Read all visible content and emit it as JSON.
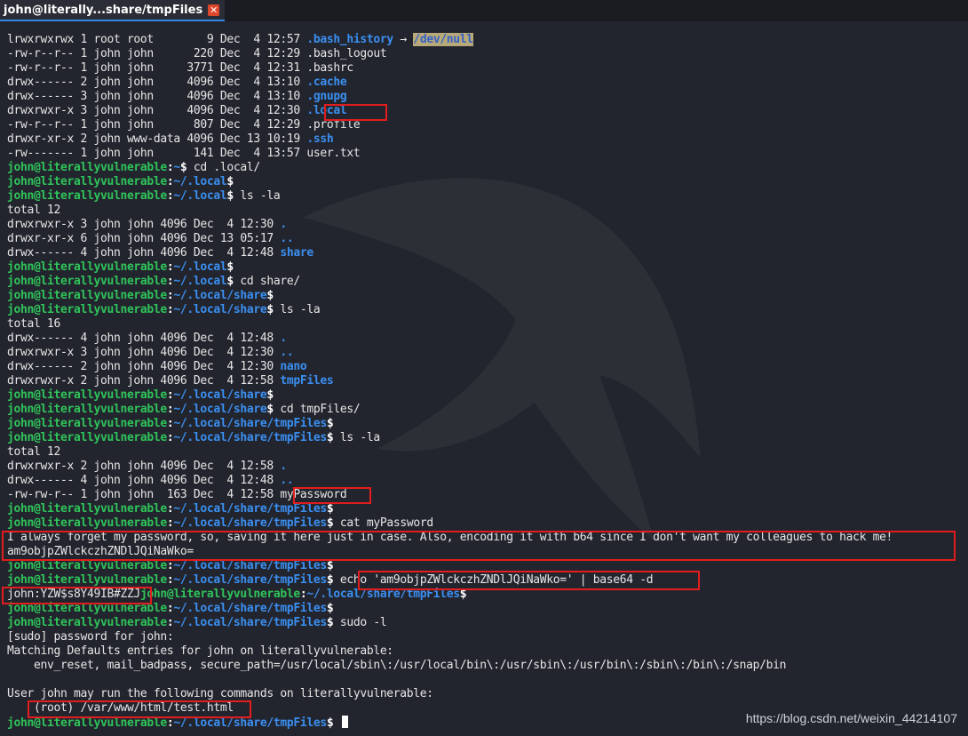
{
  "window": {
    "tab_title": "john@literally...share/tmpFiles",
    "tab_close_glyph": "✕"
  },
  "prompt": {
    "user_host": "john@literallyvulnerable",
    "colon": ":"
  },
  "terminal": {
    "lines": [
      {
        "type": "text",
        "segments": [
          {
            "t": "lrwxrwxrwx 1 root root        9 Dec  4 12:57 "
          },
          {
            "t": ".bash_history",
            "c": "blue"
          },
          {
            "t": " → "
          },
          {
            "t": "/dev/null",
            "c": "hl-null"
          }
        ]
      },
      {
        "type": "text",
        "segments": [
          {
            "t": "-rw-r--r-- 1 john john      220 Dec  4 12:29 .bash_logout"
          }
        ]
      },
      {
        "type": "text",
        "segments": [
          {
            "t": "-rw-r--r-- 1 john john     3771 Dec  4 12:31 .bashrc"
          }
        ]
      },
      {
        "type": "text",
        "segments": [
          {
            "t": "drwx------ 2 john john     4096 Dec  4 13:10 "
          },
          {
            "t": ".cache",
            "c": "blue"
          }
        ]
      },
      {
        "type": "text",
        "segments": [
          {
            "t": "drwx------ 3 john john     4096 Dec  4 13:10 "
          },
          {
            "t": ".gnupg",
            "c": "blue"
          }
        ]
      },
      {
        "type": "text",
        "segments": [
          {
            "t": "drwxrwxr-x 3 john john     4096 Dec  4 12:30 "
          },
          {
            "t": ".local",
            "c": "blue"
          }
        ]
      },
      {
        "type": "text",
        "segments": [
          {
            "t": "-rw-r--r-- 1 john john      807 Dec  4 12:29 .profile"
          }
        ]
      },
      {
        "type": "text",
        "segments": [
          {
            "t": "drwxr-xr-x 2 john www-data 4096 Dec 13 10:19 "
          },
          {
            "t": ".ssh",
            "c": "blue"
          }
        ]
      },
      {
        "type": "text",
        "segments": [
          {
            "t": "-rw------- 1 john john      141 Dec  4 13:57 user.txt"
          }
        ]
      },
      {
        "type": "prompt",
        "path": "~",
        "cmd": " cd .local/"
      },
      {
        "type": "prompt",
        "path": "~/.local",
        "cmd": ""
      },
      {
        "type": "prompt",
        "path": "~/.local",
        "cmd": " ls -la"
      },
      {
        "type": "text",
        "segments": [
          {
            "t": "total 12"
          }
        ]
      },
      {
        "type": "text",
        "segments": [
          {
            "t": "drwxrwxr-x 3 john john 4096 Dec  4 12:30 "
          },
          {
            "t": ".",
            "c": "blue"
          }
        ]
      },
      {
        "type": "text",
        "segments": [
          {
            "t": "drwxr-xr-x 6 john john 4096 Dec 13 05:17 "
          },
          {
            "t": "..",
            "c": "blue"
          }
        ]
      },
      {
        "type": "text",
        "segments": [
          {
            "t": "drwx------ 4 john john 4096 Dec  4 12:48 "
          },
          {
            "t": "share",
            "c": "blue"
          }
        ]
      },
      {
        "type": "prompt",
        "path": "~/.local",
        "cmd": ""
      },
      {
        "type": "prompt",
        "path": "~/.local",
        "cmd": " cd share/"
      },
      {
        "type": "prompt",
        "path": "~/.local/share",
        "cmd": ""
      },
      {
        "type": "prompt",
        "path": "~/.local/share",
        "cmd": " ls -la"
      },
      {
        "type": "text",
        "segments": [
          {
            "t": "total 16"
          }
        ]
      },
      {
        "type": "text",
        "segments": [
          {
            "t": "drwx------ 4 john john 4096 Dec  4 12:48 "
          },
          {
            "t": ".",
            "c": "blue"
          }
        ]
      },
      {
        "type": "text",
        "segments": [
          {
            "t": "drwxrwxr-x 3 john john 4096 Dec  4 12:30 "
          },
          {
            "t": "..",
            "c": "blue"
          }
        ]
      },
      {
        "type": "text",
        "segments": [
          {
            "t": "drwx------ 2 john john 4096 Dec  4 12:30 "
          },
          {
            "t": "nano",
            "c": "blue"
          }
        ]
      },
      {
        "type": "text",
        "segments": [
          {
            "t": "drwxrwxr-x 2 john john 4096 Dec  4 12:58 "
          },
          {
            "t": "tmpFiles",
            "c": "blue"
          }
        ]
      },
      {
        "type": "prompt",
        "path": "~/.local/share",
        "cmd": ""
      },
      {
        "type": "prompt",
        "path": "~/.local/share",
        "cmd": " cd tmpFiles/"
      },
      {
        "type": "prompt",
        "path": "~/.local/share/tmpFiles",
        "cmd": ""
      },
      {
        "type": "prompt",
        "path": "~/.local/share/tmpFiles",
        "cmd": " ls -la"
      },
      {
        "type": "text",
        "segments": [
          {
            "t": "total 12"
          }
        ]
      },
      {
        "type": "text",
        "segments": [
          {
            "t": "drwxrwxr-x 2 john john 4096 Dec  4 12:58 "
          },
          {
            "t": ".",
            "c": "blue"
          }
        ]
      },
      {
        "type": "text",
        "segments": [
          {
            "t": "drwx------ 4 john john 4096 Dec  4 12:48 "
          },
          {
            "t": "..",
            "c": "blue"
          }
        ]
      },
      {
        "type": "text",
        "segments": [
          {
            "t": "-rw-rw-r-- 1 john john  163 Dec  4 12:58 myPassword"
          }
        ]
      },
      {
        "type": "prompt",
        "path": "~/.local/share/tmpFiles",
        "cmd": ""
      },
      {
        "type": "prompt",
        "path": "~/.local/share/tmpFiles",
        "cmd": " cat myPassword"
      },
      {
        "type": "text",
        "segments": [
          {
            "t": "I always forget my password, so, saving it here just in case. Also, encoding it with b64 since I don't want my colleagues to hack me!"
          }
        ]
      },
      {
        "type": "text",
        "segments": [
          {
            "t": "am9objpZWlckczhZNDlJQiNaWko="
          }
        ]
      },
      {
        "type": "prompt",
        "path": "~/.local/share/tmpFiles",
        "cmd": ""
      },
      {
        "type": "prompt",
        "path": "~/.local/share/tmpFiles",
        "cmd": " echo 'am9objpZWlckczhZNDlJQiNaWko=' | base64 -d"
      },
      {
        "type": "prompt",
        "prefix": "john:YZW$s8Y49IB#ZZJ",
        "path": "~/.local/share/tmpFiles",
        "cmd": ""
      },
      {
        "type": "prompt",
        "path": "~/.local/share/tmpFiles",
        "cmd": ""
      },
      {
        "type": "prompt",
        "path": "~/.local/share/tmpFiles",
        "cmd": " sudo -l"
      },
      {
        "type": "text",
        "segments": [
          {
            "t": "[sudo] password for john:"
          }
        ]
      },
      {
        "type": "text",
        "segments": [
          {
            "t": "Matching Defaults entries for john on literallyvulnerable:"
          }
        ]
      },
      {
        "type": "text",
        "segments": [
          {
            "t": "    env_reset, mail_badpass, secure_path=/usr/local/sbin\\:/usr/local/bin\\:/usr/sbin\\:/usr/bin\\:/sbin\\:/bin\\:/snap/bin"
          }
        ]
      },
      {
        "type": "text",
        "segments": [
          {
            "t": ""
          }
        ]
      },
      {
        "type": "text",
        "segments": [
          {
            "t": "User john may run the following commands on literallyvulnerable:"
          }
        ]
      },
      {
        "type": "text",
        "segments": [
          {
            "t": "    (root) /var/www/html/test.html"
          }
        ]
      },
      {
        "type": "prompt",
        "path": "~/.local/share/tmpFiles",
        "cmd": " ",
        "cursor": true
      }
    ]
  },
  "watermark": "https://blog.csdn.net/weixin_44214107",
  "colors": {
    "background": "#23252e",
    "prompt_user": "#2fc45a",
    "path_blue": "#3a8ff0",
    "highlight_box": "#e11d1d",
    "tab_accent": "#3584e4"
  }
}
